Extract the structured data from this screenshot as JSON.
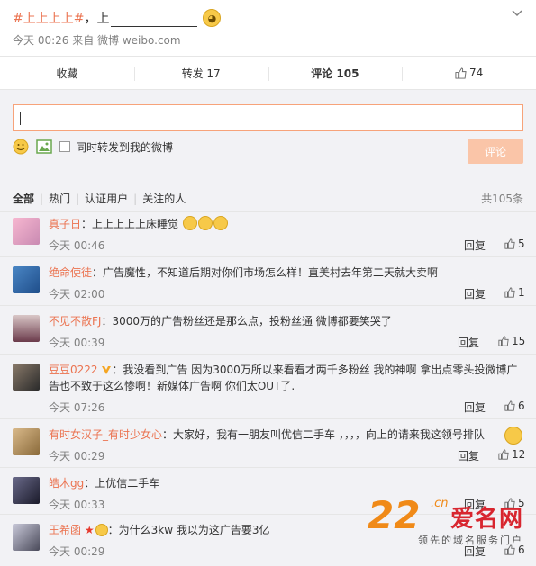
{
  "post": {
    "topic": "#上上上上#",
    "text": "，上",
    "time": "今天 00:26",
    "source": "来自 微博 weibo.com"
  },
  "actions": {
    "favorite": "收藏",
    "repost": "转发 17",
    "comment": "评论 105",
    "like": "74"
  },
  "composer": {
    "repost_label": "同时转发到我的微博",
    "submit": "评论"
  },
  "filters": {
    "items": [
      "全部",
      "热门",
      "认证用户",
      "关注的人"
    ],
    "total": "共105条"
  },
  "comments": [
    {
      "name": "真子日",
      "text": "：上上上上上床睡觉",
      "time": "今天 00:46",
      "reply": "回复",
      "likes": "5"
    },
    {
      "name": "绝命使徒",
      "text": "：广告魔性，不知道后期对你们市场怎么样！直美村去年第二天就大卖啊",
      "time": "今天 02:00",
      "reply": "回复",
      "likes": "1"
    },
    {
      "name": "不见不散FJ",
      "text": "：3000万的广告粉丝还是那么点，投粉丝通 微博都要笑哭了",
      "time": "今天 00:39",
      "reply": "回复",
      "likes": "15"
    },
    {
      "name": "豆豆0222",
      "text": "：我没看到广告 因为3000万所以来看看才两千多粉丝 我的神啊 拿出点零头投微博广告也不致于这么惨啊！新媒体广告啊 你们太OUT了.",
      "time": "今天 07:26",
      "reply": "回复",
      "likes": "6"
    },
    {
      "name": "有时女汉子_有时少女心",
      "text": "：大家好，我有一朋友叫优信二手车 ，，，，向上的请来我这领号排队",
      "time": "今天 00:29",
      "reply": "回复",
      "likes": "12"
    },
    {
      "name": "皓木gg",
      "text": "：上优信二手车",
      "time": "今天 00:33",
      "reply": "回复",
      "likes": "5"
    },
    {
      "name": "王希函",
      "text": "：为什么3kw 我以为这广告要3亿",
      "time": "今天 00:29",
      "reply": "回复",
      "likes": "6"
    }
  ],
  "watermark": {
    "num": "22",
    "cn": ".cn",
    "name": "爱名网",
    "sub": "领先的域名服务门户"
  },
  "colors": {
    "accent": "#eb7350",
    "submit_bg": "#fac5a8",
    "input_border": "#f7a37a",
    "panel_bg": "#f2f2f5"
  }
}
